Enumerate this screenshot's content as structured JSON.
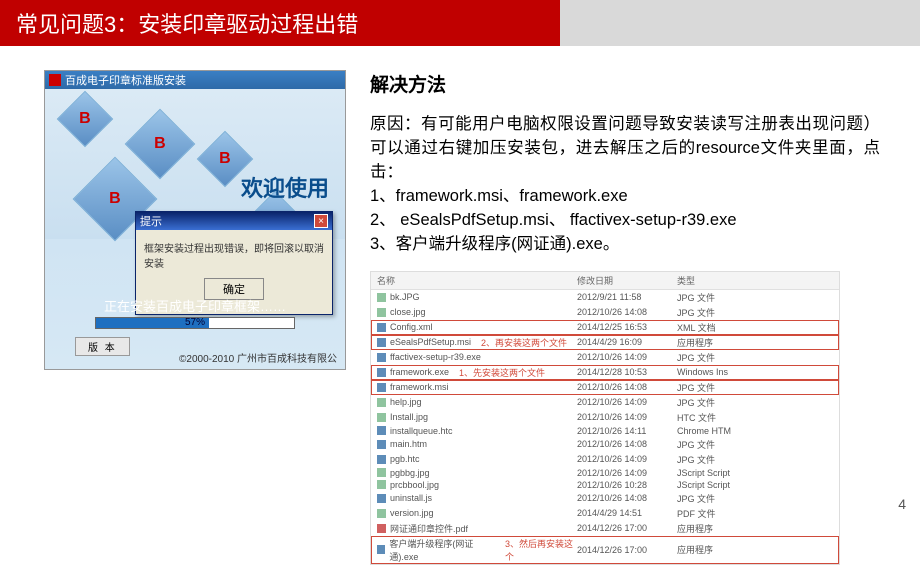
{
  "header": {
    "title": "常见问题3：安装印章驱动过程出错"
  },
  "installer": {
    "window_title": "百成电子印章标准版安装",
    "welcome": "欢迎使用",
    "dialog_title": "提示",
    "dialog_message": "框架安装过程出现错误，即将回滚以取消安装",
    "dialog_ok": "确定",
    "installing_text": "正在安装百成电子印章框架……",
    "progress_pct": "57%",
    "version_btn": "版 本",
    "copyright": "©2000-2010 广州市百成科技有限公"
  },
  "solution": {
    "title": "解决方法",
    "cause_line": "原因：有可能用户电脑权限设置问题导致安装读写注册表出现问题）  可以通过右键加压安装包，进去解压之后的resource文件夹里面，点击：",
    "step1": "1、framework.msi、framework.exe",
    "step2": "2、 eSealsPdfSetup.msi、 ffactivex-setup-r39.exe",
    "step3": "3、客户端升级程序(网证通).exe。"
  },
  "explorer": {
    "columns": {
      "name": "名称",
      "date": "修改日期",
      "type": "类型"
    },
    "annotations": {
      "a2": "2、再安装这两个文件",
      "a1": "1、先安装这两个文件",
      "a3": "3、然后再安装这个"
    },
    "rows": [
      {
        "name": "bk.JPG",
        "date": "2012/9/21 11:58",
        "type": "JPG 文件",
        "icon": "img"
      },
      {
        "name": "close.jpg",
        "date": "2012/10/26 14:08",
        "type": "JPG 文件",
        "icon": "img"
      },
      {
        "name": "Config.xml",
        "date": "2014/12/25 16:53",
        "type": "XML 文档",
        "icon": "exe",
        "boxed": true
      },
      {
        "name": "eSealsPdfSetup.msi",
        "date": "2014/4/29 16:09",
        "type": "应用程序",
        "icon": "exe",
        "boxed": true,
        "note": "a2"
      },
      {
        "name": "ffactivex-setup-r39.exe",
        "date": "2012/10/26 14:09",
        "type": "JPG 文件",
        "icon": "exe"
      },
      {
        "name": "framework.exe",
        "date": "2014/12/28 10:53",
        "type": "Windows Ins",
        "icon": "exe",
        "boxed": true,
        "note": "a1"
      },
      {
        "name": "framework.msi",
        "date": "2012/10/26 14:08",
        "type": "JPG 文件",
        "icon": "exe",
        "boxed": true
      },
      {
        "name": "help.jpg",
        "date": "2012/10/26 14:09",
        "type": "JPG 文件",
        "icon": "img"
      },
      {
        "name": "Install.jpg",
        "date": "2012/10/26 14:09",
        "type": "HTC 文件",
        "icon": "img"
      },
      {
        "name": "installqueue.htc",
        "date": "2012/10/26 14:11",
        "type": "Chrome HTM",
        "icon": "exe"
      },
      {
        "name": "main.htm",
        "date": "2012/10/26 14:08",
        "type": "JPG 文件",
        "icon": "exe"
      },
      {
        "name": "pgb.htc",
        "date": "2012/10/26 14:09",
        "type": "JPG 文件",
        "icon": "exe"
      },
      {
        "name": "pgbbg.jpg",
        "date": "2012/10/26 14:09",
        "type": "JScript Script",
        "icon": "img"
      },
      {
        "name": "prcbbool.jpg",
        "date": "2012/10/26 10:28",
        "type": "JScript Script",
        "icon": "img"
      },
      {
        "name": "uninstall.js",
        "date": "2012/10/26 14:08",
        "type": "JPG 文件",
        "icon": "exe"
      },
      {
        "name": "version.jpg",
        "date": "2014/4/29 14:51",
        "type": "PDF 文件",
        "icon": "img"
      },
      {
        "name": "网证通印章控件.pdf",
        "date": "2014/12/26 17:00",
        "type": "应用程序",
        "icon": "pdf"
      },
      {
        "name": "客户端升级程序(网证通).exe",
        "date": "2014/12/26 17:00",
        "type": "应用程序",
        "icon": "exe",
        "boxed": true,
        "note": "a3"
      }
    ]
  },
  "page_number": "4"
}
